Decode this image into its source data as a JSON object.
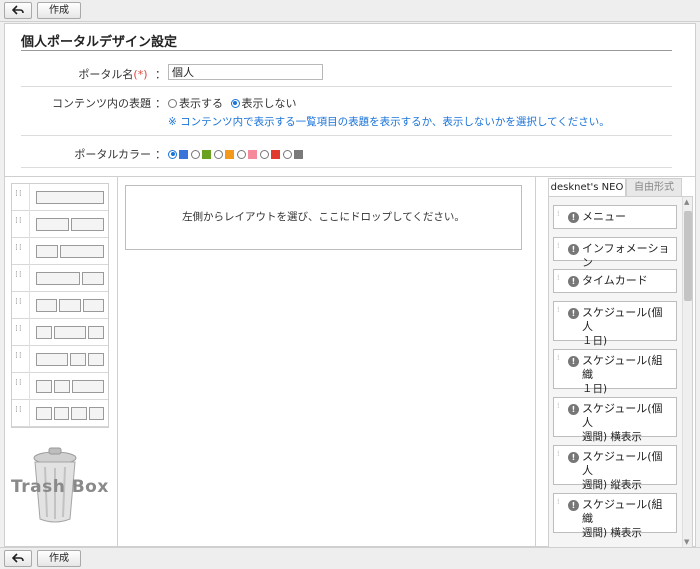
{
  "toolbar": {
    "create_label": "作成",
    "back_icon": "back-arrow-icon"
  },
  "page": {
    "title": "個人ポータルデザイン設定"
  },
  "form": {
    "name_label": "ポータル名",
    "required_mark": "(*)",
    "colon": "：",
    "name_value": "個人",
    "header_label": "コンテンツ内の表題",
    "option_show": "表示する",
    "option_hide": "表示しない",
    "selected_option": "表示しない",
    "note": "※ コンテンツ内で表示する一覧項目の表題を表示するか、表示しないかを選択してください。",
    "color_label": "ポータルカラー",
    "colors": [
      "#3a73d9",
      "#6aa121",
      "#f39a1c",
      "#f58a9a",
      "#e2392f",
      "#7a7a7a"
    ],
    "selected_color_index": 0
  },
  "workspace": {
    "layouts": [
      [
        1
      ],
      [
        1,
        1
      ],
      [
        1,
        2
      ],
      [
        2,
        1
      ],
      [
        1,
        1,
        1
      ],
      [
        1,
        2,
        1
      ],
      [
        2,
        1,
        1
      ],
      [
        1,
        1,
        2
      ],
      [
        1,
        1,
        1,
        1
      ]
    ],
    "trash_label": "Trash Box",
    "drop_hint": "左側からレイアウトを選び、ここにドロップしてください。"
  },
  "sidebar": {
    "tabs": [
      "desknet's NEO",
      "自由形式"
    ],
    "active_tab": 0,
    "items": [
      {
        "line1": "メニュー",
        "line2": ""
      },
      {
        "line1": "インフォメーション",
        "line2": ""
      },
      {
        "line1": "タイムカード",
        "line2": ""
      },
      {
        "line1": "スケジュール(個人",
        "line2": "１日)"
      },
      {
        "line1": "スケジュール(組織",
        "line2": "１日)"
      },
      {
        "line1": "スケジュール(個人",
        "line2": "週間) 横表示"
      },
      {
        "line1": "スケジュール(個人",
        "line2": "週間) 縦表示"
      },
      {
        "line1": "スケジュール(組織",
        "line2": "週間) 横表示"
      }
    ]
  }
}
